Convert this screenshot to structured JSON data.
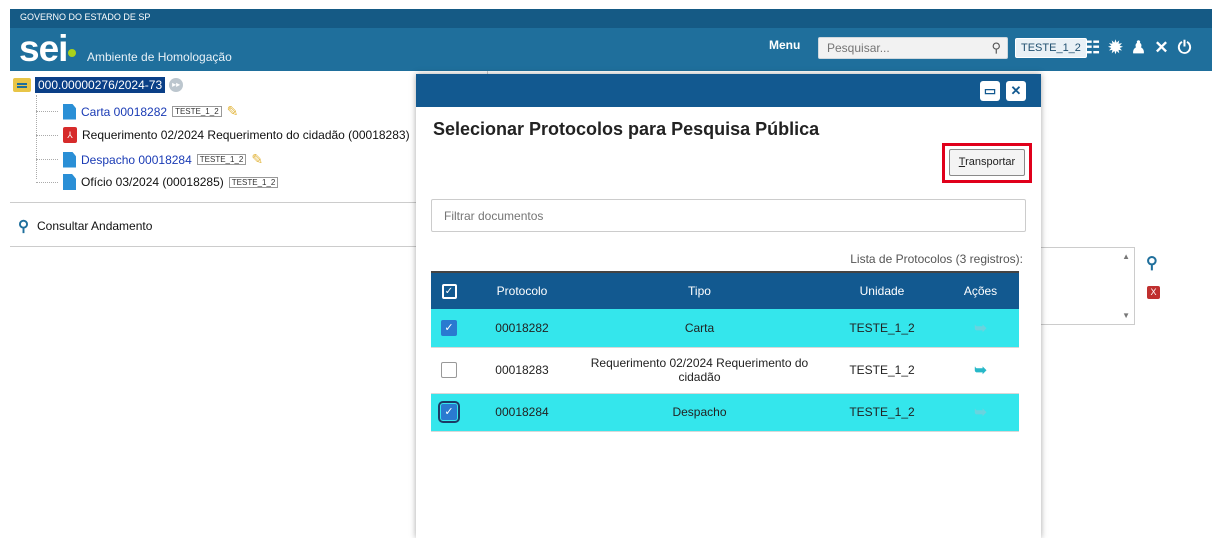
{
  "gov_bar": {
    "label": "GOVERNO DO ESTADO DE SP"
  },
  "header": {
    "logo": "sei",
    "environment": "Ambiente de Homologação",
    "menu_label": "Menu",
    "search_placeholder": "Pesquisar...",
    "unit": "TESTE_1_2",
    "icons": [
      "list-icon",
      "alert-icon",
      "user-icon",
      "tools-icon",
      "power-icon"
    ]
  },
  "tree": {
    "process_number": "000.00000276/2024-73",
    "documents": [
      {
        "label": "Carta 00018282",
        "tag": "TESTE_1_2",
        "type": "doc",
        "linked": true,
        "pencil": true
      },
      {
        "label": "Requerimento 02/2024 Requerimento do cidadão (00018283)",
        "tag": "",
        "type": "pdf",
        "linked": false,
        "pencil": false
      },
      {
        "label": "Despacho 00018284",
        "tag": "TESTE_1_2",
        "type": "doc",
        "linked": true,
        "pencil": true
      },
      {
        "label": "Ofício 03/2024 (00018285)",
        "tag": "TESTE_1_2",
        "type": "doc",
        "linked": false,
        "pencil": false
      }
    ],
    "consult_label": "Consultar Andamento"
  },
  "modal": {
    "title": "Selecionar Protocolos para Pesquisa Pública",
    "transport_prefix": "T",
    "transport_rest": "ransportar",
    "filter_placeholder": "Filtrar documentos",
    "caption": "Lista de Protocolos (3 registros):",
    "columns": [
      "Protocolo",
      "Tipo",
      "Unidade",
      "Ações"
    ],
    "rows": [
      {
        "protocolo": "00018282",
        "tipo": "Carta",
        "unidade": "TESTE_1_2",
        "checked": true
      },
      {
        "protocolo": "00018283",
        "tipo": "Requerimento 02/2024 Requerimento do cidadão",
        "unidade": "TESTE_1_2",
        "checked": false
      },
      {
        "protocolo": "00018284",
        "tipo": "Despacho",
        "unidade": "TESTE_1_2",
        "checked": true
      }
    ]
  },
  "colors": {
    "header": "#1f6f9c",
    "modal_bar": "#125990",
    "selected_row": "#34e6ec",
    "highlight": "#e0001b"
  }
}
